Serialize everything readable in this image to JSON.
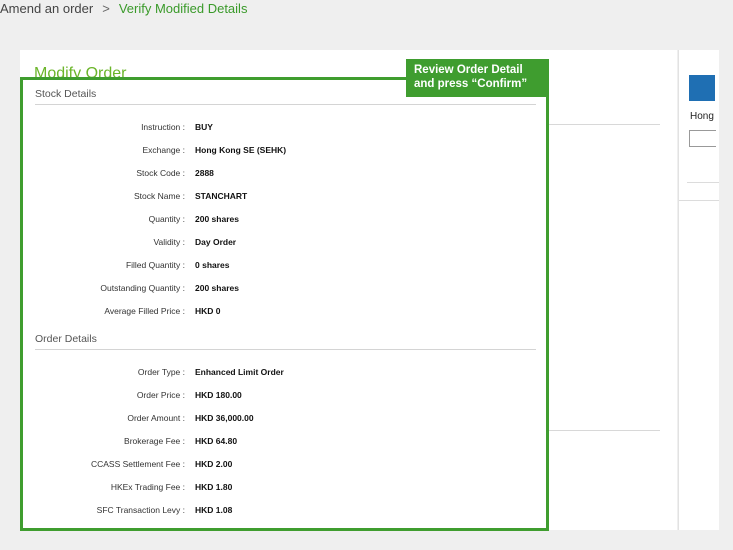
{
  "breadcrumb": {
    "parent": "Amend an order",
    "separator": ">",
    "current": "Verify Modified Details"
  },
  "panel": {
    "title": "Modify Order"
  },
  "right_panel": {
    "text": "Hong"
  },
  "callout": {
    "line1": "Review Order Detail",
    "line2": "and press “Confirm”"
  },
  "stock_details": {
    "title": "Stock Details",
    "rows": [
      {
        "label": "Instruction :",
        "value": "BUY"
      },
      {
        "label": "Exchange :",
        "value": "Hong Kong SE (SEHK)"
      },
      {
        "label": "Stock Code :",
        "value": "2888"
      },
      {
        "label": "Stock Name :",
        "value": "STANCHART"
      },
      {
        "label": "Quantity :",
        "value": "200  shares"
      },
      {
        "label": "Validity :",
        "value": "Day Order"
      },
      {
        "label": "Filled Quantity :",
        "value": "0  shares"
      },
      {
        "label": "Outstanding Quantity :",
        "value": "200  shares"
      },
      {
        "label": "Average Filled Price :",
        "value": "HKD 0"
      }
    ]
  },
  "order_details": {
    "title": "Order Details",
    "rows": [
      {
        "label": "Order Type :",
        "value": "Enhanced Limit Order"
      },
      {
        "label": "Order Price :",
        "value": "HKD  180.00"
      },
      {
        "label": "Order Amount :",
        "value": "HKD  36,000.00"
      },
      {
        "label": "Brokerage Fee :",
        "value": "HKD  64.80"
      },
      {
        "label": "CCASS Settlement Fee :",
        "value": "HKD  2.00"
      },
      {
        "label": "HKEx Trading Fee :",
        "value": "HKD  1.80"
      },
      {
        "label": "SFC Transaction Levy :",
        "value": "HKD  1.08"
      }
    ]
  }
}
